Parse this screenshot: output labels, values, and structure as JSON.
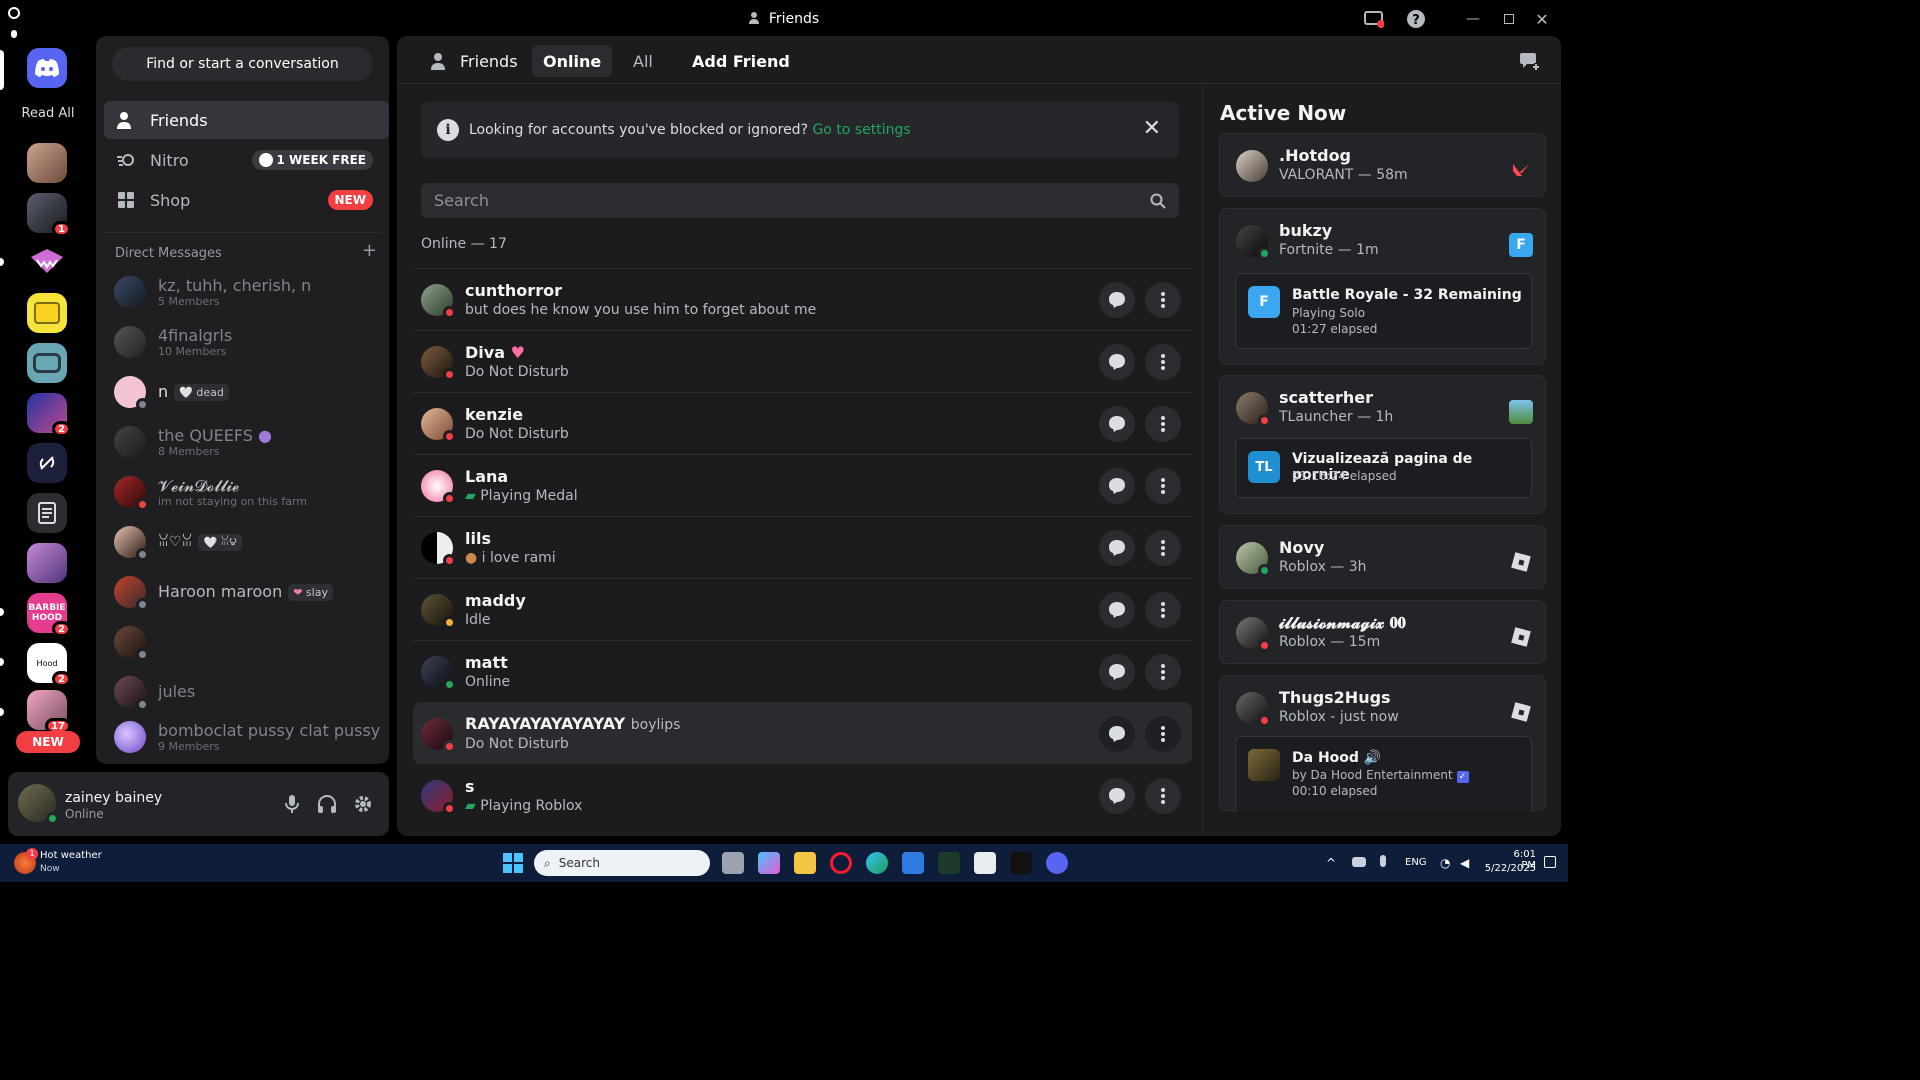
{
  "window": {
    "title": "Friends"
  },
  "guilds": {
    "read_all": "Read All",
    "badges": {
      "g2": "1",
      "g7": "2",
      "g12": "2",
      "g13": "2",
      "g14": "17"
    },
    "new_label": "NEW"
  },
  "dm": {
    "find_button": "Find or start a conversation",
    "nav": {
      "friends": "Friends",
      "nitro": "Nitro",
      "nitro_pill": "1 WEEK FREE",
      "shop": "Shop",
      "shop_pill": "NEW"
    },
    "header": "Direct Messages",
    "rows": [
      {
        "name": "kz, tuhh, cherish, n",
        "sub": "5 Members"
      },
      {
        "name": "4finalgrls",
        "sub": "10 Members"
      },
      {
        "name": "n",
        "tag": "dead"
      },
      {
        "name": "the QUEEFS",
        "sub": "8 Members"
      },
      {
        "name": "𝓥𝓮𝓲𝓷𝓓𝓸𝓵𝓵𝓲𝓮",
        "sub": "im not staying on this farm"
      },
      {
        "name": "ꈍ♡ꈍ",
        "tag": "ꈍ౪"
      },
      {
        "name": "Haroon maroon",
        "tag": "slay"
      },
      {
        "name": ""
      },
      {
        "name": "jules"
      },
      {
        "name": "bomboclat pussy clat pussy",
        "sub": "9 Members"
      }
    ]
  },
  "user": {
    "name": "zainey bainey",
    "status": "Online"
  },
  "topbar": {
    "friends": "Friends",
    "online": "Online",
    "all": "All",
    "add_friend": "Add Friend"
  },
  "notice": {
    "text": "Looking for accounts you've blocked or ignored?",
    "link": "Go to settings"
  },
  "search": {
    "placeholder": "Search"
  },
  "online_header": "Online — 17",
  "friends": [
    {
      "name": "cunthorror",
      "status": "but does he know you use him to forget about me"
    },
    {
      "name": "Diva",
      "status": "Do Not Disturb"
    },
    {
      "name": "kenzie",
      "status": "Do Not Disturb"
    },
    {
      "name": "Lana",
      "status": "Playing Medal"
    },
    {
      "name": "lils",
      "status": "i love rami"
    },
    {
      "name": "maddy",
      "status": "Idle"
    },
    {
      "name": "matt",
      "status": "Online"
    },
    {
      "name": "RAYAYAYAYAYAYAY",
      "tag": "boylips",
      "status": "Do Not Disturb"
    },
    {
      "name": "s",
      "status": "Playing Roblox"
    }
  ],
  "active_now": {
    "title": "Active Now",
    "cards": [
      {
        "name": ".Hotdog",
        "sub": "VALORANT — 58m"
      },
      {
        "name": "bukzy",
        "sub": "Fortnite — 1m",
        "detail_title": "Battle Royale - 32 Remaining",
        "detail_line1": "Playing Solo",
        "detail_line2": "01:27 elapsed"
      },
      {
        "name": "scatterher",
        "sub": "TLauncher — 1h",
        "detail_title": "Vizualizează pagina de pornire",
        "detail_line1": "01:16:24 elapsed",
        "icon_text": "TL"
      },
      {
        "name": "Novy",
        "sub": "Roblox — 3h"
      },
      {
        "name": "𝓲𝓵𝓵𝓾𝓼𝓲𝓸𝓷𝓶𝓪𝓰𝓲𝔁 𝟎𝟎",
        "sub": "Roblox — 15m"
      },
      {
        "name": "Thugs2Hugs",
        "sub": "Roblox - just now",
        "detail_title": "Da Hood",
        "detail_line1": "by Da Hood Entertainment",
        "detail_line2": "00:10 elapsed"
      }
    ]
  },
  "taskbar": {
    "weather_title": "Hot weather",
    "weather_sub": "Now",
    "weather_badge": "1",
    "search": "Search",
    "lang": "ENG",
    "time": "6:01 PM",
    "date": "5/22/2025"
  },
  "colors": {
    "accent": "#5865f2",
    "online": "#23a55a",
    "dnd": "#f23f43",
    "idle": "#f0b232",
    "link": "#00a8fc"
  }
}
